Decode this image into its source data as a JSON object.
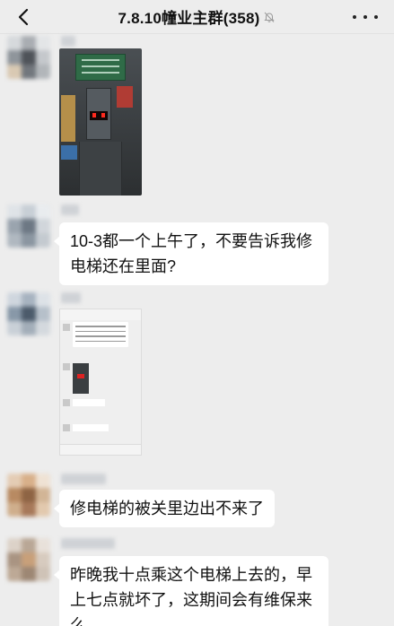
{
  "header": {
    "back_icon": "chevron-left-icon",
    "title": "7.8.10幢业主群(358)",
    "mute_icon": "bell-off-icon",
    "more_icon": "ellipsis-icon"
  },
  "messages": [
    {
      "type": "image",
      "content": "elevator-photo"
    },
    {
      "type": "text",
      "text_lines": [
        "10-3都一个上午了，不要告诉我修",
        "电梯还在里面?"
      ]
    },
    {
      "type": "image",
      "content": "chat-screenshot"
    },
    {
      "type": "text",
      "text_lines": [
        "修电梯的被关里边出不来了"
      ]
    },
    {
      "type": "text",
      "text_lines": [
        "昨晚我十点乘这个电梯上去的，早",
        "上七点就坏了，这期间会有维保来",
        "么"
      ]
    }
  ],
  "colors": {
    "background": "#ededed",
    "bubble": "#ffffff",
    "text": "#111111"
  }
}
